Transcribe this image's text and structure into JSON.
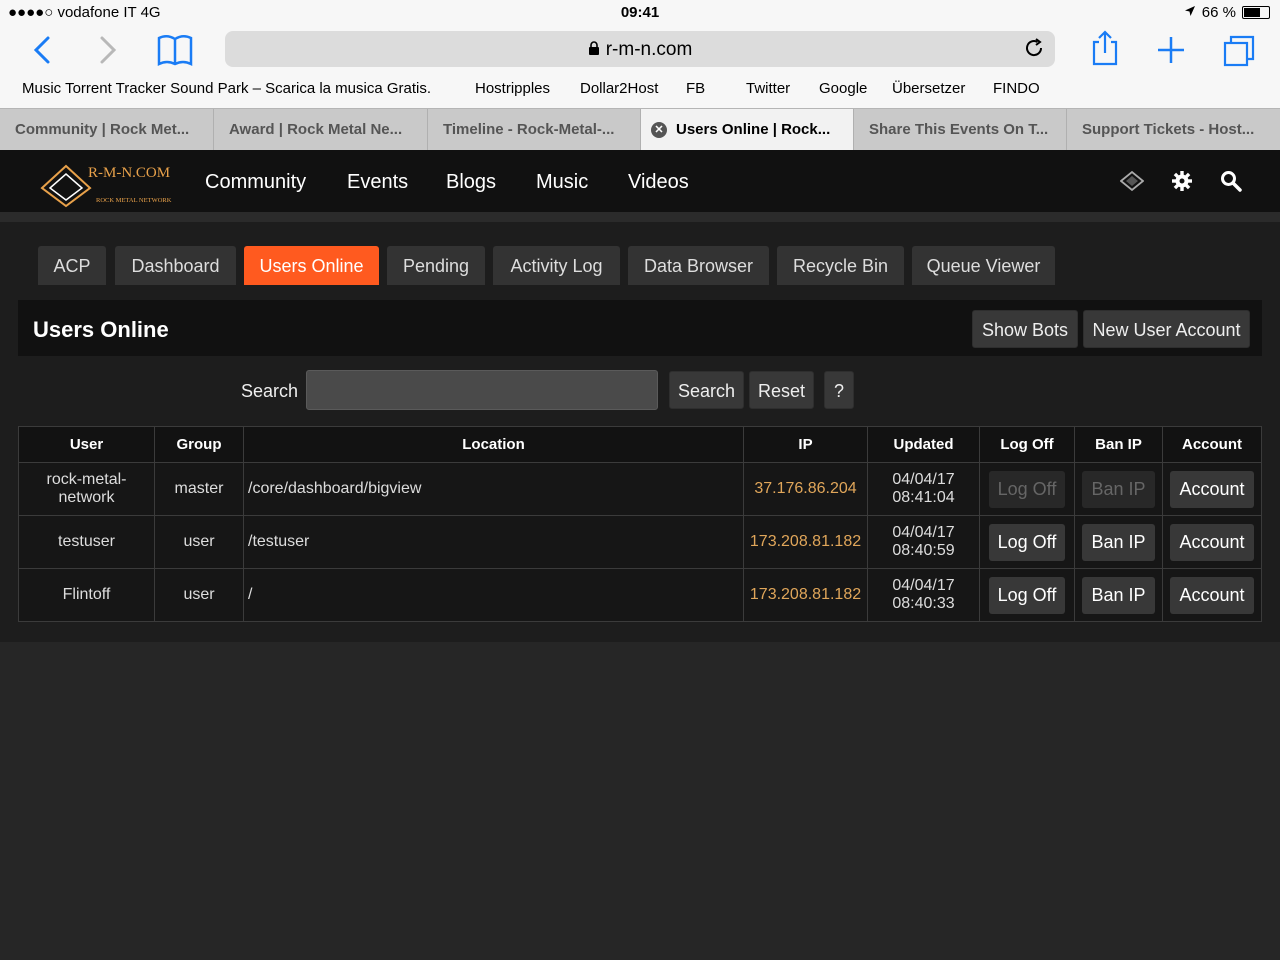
{
  "status": {
    "carrier": "●●●●○ vodafone IT   4G",
    "time": "09:41",
    "battery": "66 %"
  },
  "browser": {
    "url": "r-m-n.com",
    "bookmarks": [
      "Music Torrent Tracker Sound Park – Scarica la musica Gratis.",
      "Hostripples",
      "Dollar2Host",
      "FB",
      "Twitter",
      "Google",
      "Übersetzer",
      "FINDO"
    ],
    "tabs": [
      "Community | Rock Met...",
      "Award | Rock Metal Ne...",
      "Timeline - Rock-Metal-...",
      "Users Online | Rock...",
      "Share This Events On T...",
      "Support Tickets - Host..."
    ]
  },
  "site": {
    "logo": {
      "main": "R-M-N.COM",
      "sub": "ROCK METAL NETWORK"
    },
    "nav": [
      "Community",
      "Events",
      "Blogs",
      "Music",
      "Videos"
    ]
  },
  "acp_tabs": [
    "ACP",
    "Dashboard",
    "Users Online",
    "Pending",
    "Activity Log",
    "Data Browser",
    "Recycle Bin",
    "Queue Viewer"
  ],
  "panel": {
    "title": "Users Online",
    "show_bots": "Show Bots",
    "new_account": "New User Account",
    "search_label": "Search",
    "search_button": "Search",
    "reset_button": "Reset",
    "help_button": "?"
  },
  "table": {
    "headers": [
      "User",
      "Group",
      "Location",
      "IP",
      "Updated",
      "Log Off",
      "Ban IP",
      "Account"
    ],
    "rows": [
      {
        "user": "rock-metal-network",
        "group": "master",
        "location": "/core/dashboard/bigview",
        "ip": "37.176.86.204",
        "date": "04/04/17",
        "time": "08:41:04",
        "logoff": "Log Off",
        "ban": "Ban IP",
        "account": "Account",
        "disabled": true
      },
      {
        "user": "testuser",
        "group": "user",
        "location": "/testuser",
        "ip": "173.208.81.182",
        "date": "04/04/17",
        "time": "08:40:59",
        "logoff": "Log Off",
        "ban": "Ban IP",
        "account": "Account",
        "disabled": false
      },
      {
        "user": "Flintoff",
        "group": "user",
        "location": "/",
        "ip": "173.208.81.182",
        "date": "04/04/17",
        "time": "08:40:33",
        "logoff": "Log Off",
        "ban": "Ban IP",
        "account": "Account",
        "disabled": false
      }
    ]
  },
  "colors": {
    "accent": "#ff5a1f",
    "ip": "#e0a65a",
    "ios_blue": "#1a7cf5"
  }
}
